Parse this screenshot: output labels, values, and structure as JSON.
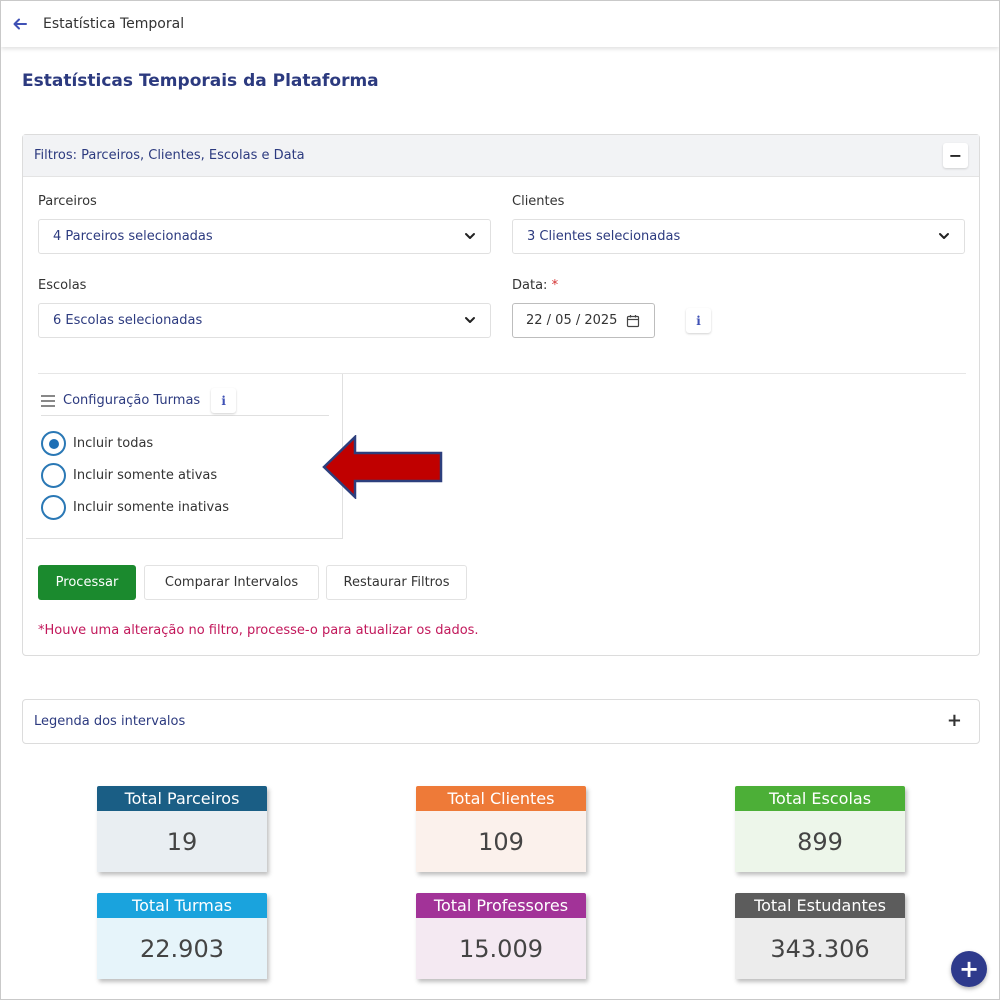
{
  "topbar": {
    "title": "Estatística Temporal"
  },
  "page_title": "Estatísticas Temporais da Plataforma",
  "filters": {
    "header": "Filtros: Parceiros, Clientes, Escolas e Data",
    "parceiros": {
      "label": "Parceiros",
      "value": "4 Parceiros selecionadas"
    },
    "clientes": {
      "label": "Clientes",
      "value": "3 Clientes selecionadas"
    },
    "escolas": {
      "label": "Escolas",
      "value": "6 Escolas selecionadas"
    },
    "data": {
      "label": "Data:",
      "required_mark": "*",
      "value": "22 / 05 / 2025"
    },
    "info_glyph": "i",
    "config_turmas": {
      "title": "Configuração Turmas",
      "options": [
        "Incluir todas",
        "Incluir somente ativas",
        "Incluir somente inativas"
      ],
      "selected": "Incluir todas"
    },
    "buttons": {
      "process": "Processar",
      "compare": "Comparar Intervalos",
      "reset": "Restaurar Filtros"
    },
    "warning": "*Houve uma alteração no filtro, processe-o para atualizar os dados.",
    "collapse_symbol": "−"
  },
  "legend": {
    "title": "Legenda dos intervalos",
    "expand_symbol": "+"
  },
  "stats": [
    {
      "label": "Total Parceiros",
      "value": "19",
      "header_color": "#1a5e85",
      "body_color": "#e9eef2"
    },
    {
      "label": "Total Clientes",
      "value": "109",
      "header_color": "#ee7a38",
      "body_color": "#fbf1ec"
    },
    {
      "label": "Total Escolas",
      "value": "899",
      "header_color": "#4caf37",
      "body_color": "#edf6ea"
    },
    {
      "label": "Total Turmas",
      "value": "22.903",
      "header_color": "#1aa3dd",
      "body_color": "#e6f4fa"
    },
    {
      "label": "Total Professores",
      "value": "15.009",
      "header_color": "#a23398",
      "body_color": "#f4e9f2"
    },
    {
      "label": "Total Estudantes",
      "value": "343.306",
      "header_color": "#5c5c5c",
      "body_color": "#ececec"
    }
  ],
  "fab": {
    "symbol": "+"
  },
  "colors": {
    "accent": "#2c3a7f",
    "primary_button": "#1b8a2e",
    "warning": "#c2185b",
    "arrow": "#c00000"
  }
}
